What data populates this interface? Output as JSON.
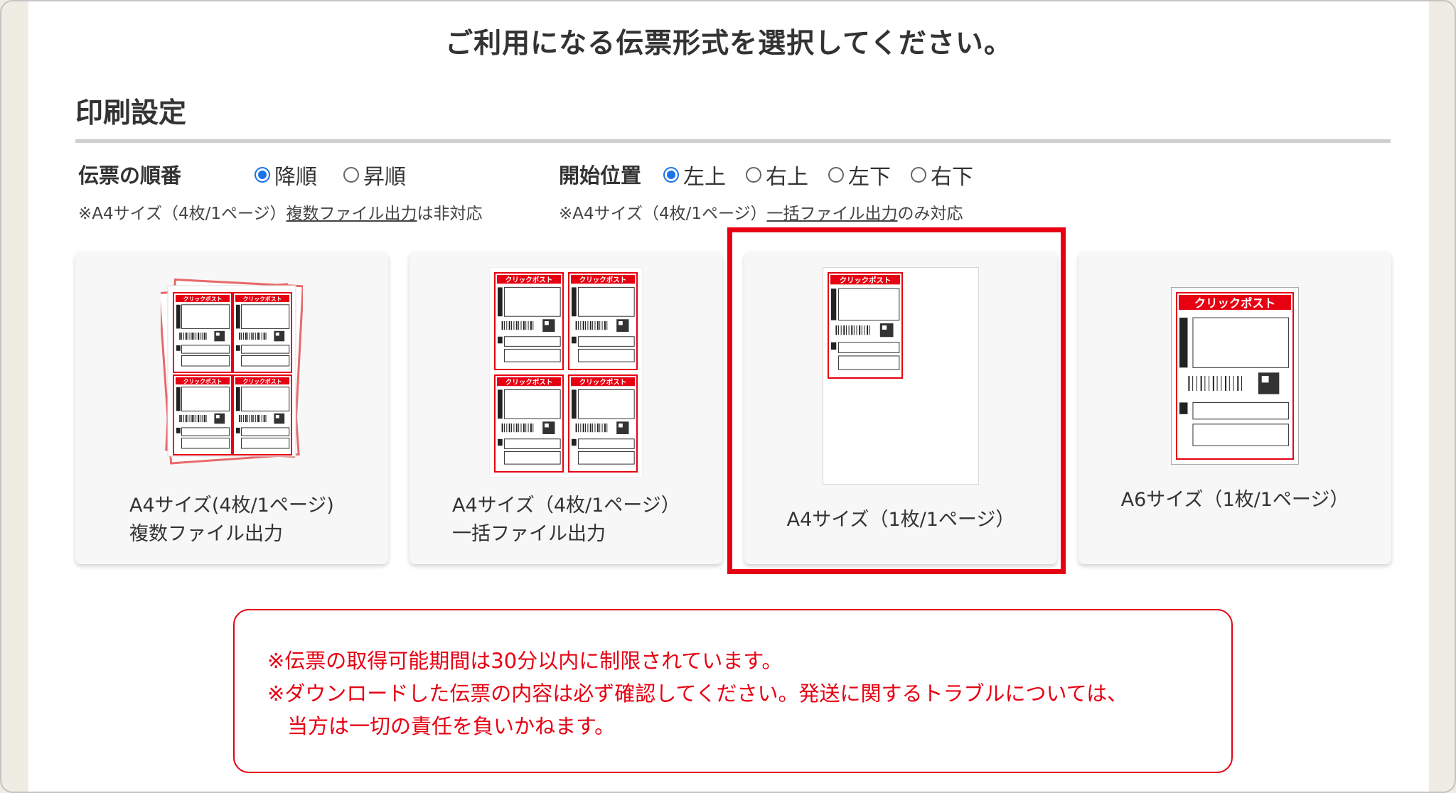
{
  "heading": "ご利用になる伝票形式を選択してください。",
  "section_title": "印刷設定",
  "order": {
    "label": "伝票の順番",
    "options": [
      {
        "label": "降順",
        "selected": true
      },
      {
        "label": "昇順",
        "selected": false
      }
    ],
    "note_prefix": "※A4サイズ（4枚/1ページ）",
    "note_link": "複数ファイル出力",
    "note_suffix": "は非対応"
  },
  "start_position": {
    "label": "開始位置",
    "options": [
      {
        "label": "左上",
        "selected": true
      },
      {
        "label": "右上",
        "selected": false
      },
      {
        "label": "左下",
        "selected": false
      },
      {
        "label": "右下",
        "selected": false
      }
    ],
    "note_prefix": "※A4サイズ（4枚/1ページ）",
    "note_link": "一括ファイル出力",
    "note_suffix": "のみ対応"
  },
  "formats": [
    {
      "line1": "A4サイズ(4枚/1ページ)",
      "line2": "複数ファイル出力"
    },
    {
      "line1": "A4サイズ（4枚/1ページ）",
      "line2": "一括ファイル出力"
    },
    {
      "line1": "A4サイズ（1枚/1ページ）",
      "line2": ""
    },
    {
      "line1": "A6サイズ（1枚/1ページ）",
      "line2": ""
    }
  ],
  "selected_format_index": 2,
  "label_brand": "クリックポスト",
  "warning": {
    "line1": "※伝票の取得可能期間は30分以内に制限されています。",
    "line2": "※ダウンロードした伝票の内容は必ず確認してください。発送に関するトラブルについては、",
    "line3": "当方は一切の責任を負いかねます。"
  },
  "colors": {
    "accent_red": "#e60012",
    "radio_blue": "#1a73e8"
  }
}
